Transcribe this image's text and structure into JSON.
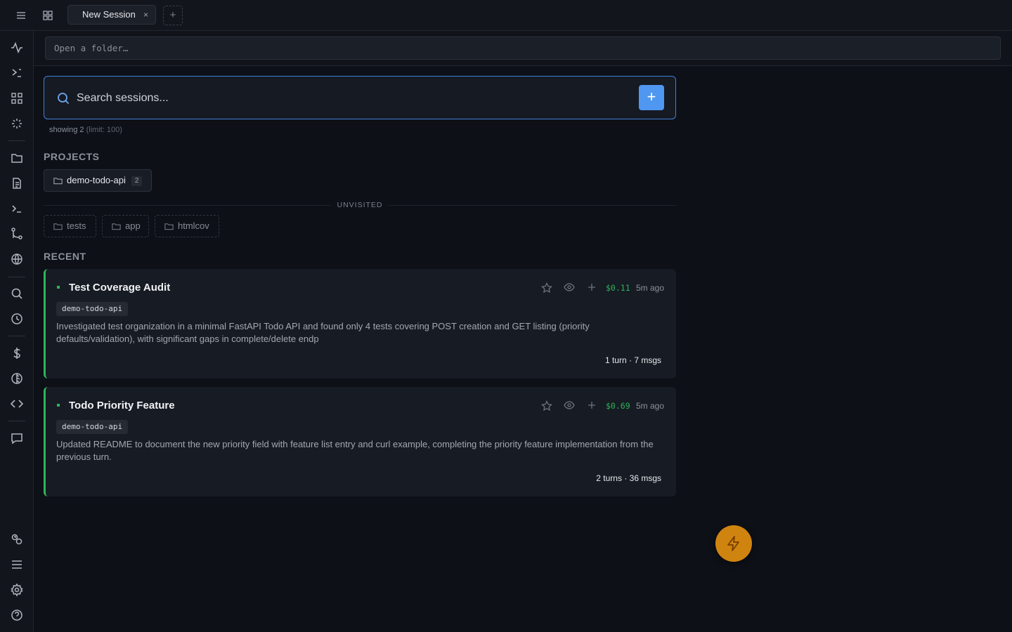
{
  "tabs": [
    {
      "label": "New Session",
      "close": "×"
    }
  ],
  "new_tab_label": "+",
  "folder": {
    "placeholder": "Open a folder…"
  },
  "search": {
    "placeholder": "Search sessions...",
    "add_label": "+"
  },
  "showing": {
    "label": "showing 2",
    "limit": "(limit: 100)"
  },
  "projects": {
    "title": "PROJECTS",
    "items": [
      {
        "name": "demo-todo-api",
        "count": "2"
      }
    ],
    "unvisited_label": "UNVISITED",
    "unvisited": [
      {
        "name": "tests"
      },
      {
        "name": "app"
      },
      {
        "name": "htmlcov"
      }
    ]
  },
  "recent": {
    "title": "RECENT",
    "sessions": [
      {
        "title": "Test Coverage Audit",
        "cost": "$0.11",
        "time": "5m ago",
        "project": "demo-todo-api",
        "summary": "Investigated test organization in a minimal FastAPI Todo API and found only 4 tests covering POST creation and GET listing (priority defaults/validation), with significant gaps in complete/delete endp",
        "stats": "1 turn · 7 msgs"
      },
      {
        "title": "Todo Priority Feature",
        "cost": "$0.69",
        "time": "5m ago",
        "project": "demo-todo-api",
        "summary": "Updated README to document the new priority field with feature list entry and curl example, completing the priority feature implementation from the previous turn.",
        "stats": "2 turns · 36 msgs"
      }
    ]
  },
  "colors": {
    "accent": "#4f97f0",
    "active_session": "#2fb35a",
    "fab": "#d08410"
  },
  "icons": {
    "topbar": [
      "menu-icon",
      "grid-icon"
    ],
    "sidebar": [
      "activity-icon",
      "terminal-prompt-icon",
      "dashboard-icon",
      "loader-icon",
      "folder-icon",
      "file-icon",
      "terminal-icon",
      "git-branch-icon",
      "globe-icon",
      "search-icon",
      "history-icon",
      "dollar-icon",
      "contrast-icon",
      "code-icon",
      "message-icon",
      "key-icon",
      "list-icon",
      "settings-icon",
      "help-icon"
    ],
    "session_actions": [
      "star-icon",
      "eye-icon",
      "plus-icon"
    ],
    "fab": "lightning-icon"
  }
}
